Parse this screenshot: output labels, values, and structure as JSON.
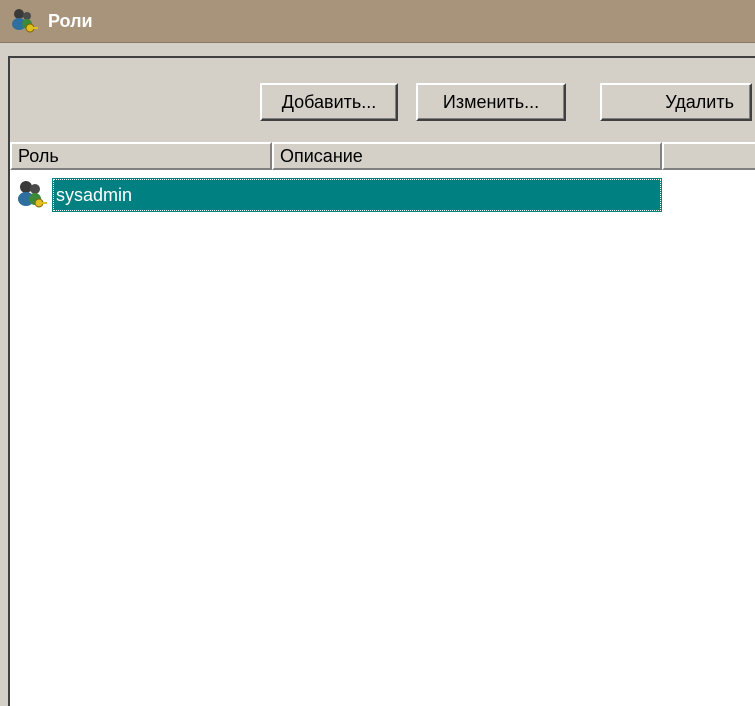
{
  "window": {
    "title": "Роли",
    "icon": "roles-users-key-icon"
  },
  "toolbar": {
    "add_label": "Добавить...",
    "edit_label": "Изменить...",
    "delete_label": "Удалить"
  },
  "list": {
    "columns": [
      "Роль",
      "Описание",
      ""
    ],
    "rows": [
      {
        "role": "sysadmin",
        "description": "",
        "icon": "role-icon",
        "selected": true
      }
    ]
  },
  "colors": {
    "titlebar": "#a8947a",
    "selection": "#008080",
    "face": "#d4d0c8"
  }
}
